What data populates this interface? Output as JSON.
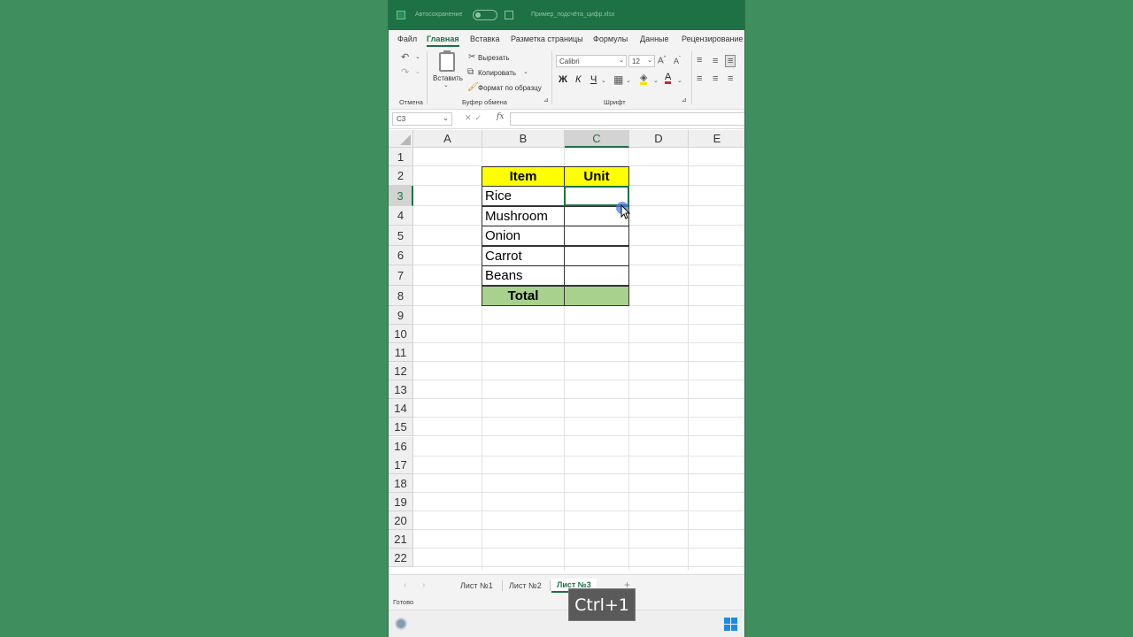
{
  "titlebar": {
    "autosave_label": "Автосохранение",
    "filename": "Пример_подсчёта_цифр.xlsx"
  },
  "menu": {
    "items": [
      "Файл",
      "Главная",
      "Вставка",
      "Разметка страницы",
      "Формулы",
      "Данные",
      "Рецензирование"
    ],
    "active": "Главная"
  },
  "ribbon": {
    "undo_group": "Отмена",
    "paste_label": "Вставить",
    "cut_label": "Вырезать",
    "copy_label": "Копировать",
    "format_painter_label": "Формат по образцу",
    "clipboard_group": "Буфер обмена",
    "font_name": "Calibri",
    "font_size": "12",
    "bold": "Ж",
    "italic": "К",
    "underline": "Ч",
    "font_group": "Шрифт"
  },
  "formula_bar": {
    "name_box": "C3",
    "fx_label": "fx",
    "formula": ""
  },
  "sheet": {
    "columns": [
      "A",
      "B",
      "C",
      "D",
      "E"
    ],
    "selected_column": "C",
    "rows": [
      "1",
      "2",
      "3",
      "4",
      "5",
      "6",
      "7",
      "8",
      "9",
      "10",
      "11",
      "12",
      "13",
      "14",
      "15",
      "16",
      "17",
      "18",
      "19",
      "20",
      "21",
      "22"
    ],
    "selected_row": "3",
    "table": {
      "header_item": "Item",
      "header_unit": "Unit",
      "items": [
        "Rice",
        "Mushroom",
        "Onion",
        "Carrot",
        "Beans"
      ],
      "total_label": "Total"
    },
    "colors": {
      "header_fill": "#ffff00",
      "total_fill": "#a9d18e",
      "accent": "#1e7145"
    }
  },
  "tabs": {
    "items": [
      "Лист №1",
      "Лист №2",
      "Лист №3"
    ],
    "active": "Лист №3",
    "add_label": "+"
  },
  "status": {
    "text": "Готово"
  },
  "overlay": {
    "shortcut": "Ctrl+1"
  }
}
